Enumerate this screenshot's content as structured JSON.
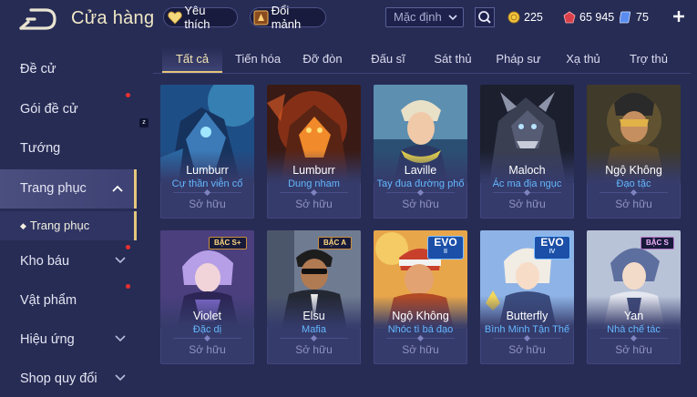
{
  "header": {
    "title": "Cửa hàng",
    "favorite_label": "Yêu thích",
    "fragment_label": "Đổi mảnh",
    "sort_value": "Mặc định",
    "currencies": [
      {
        "name": "gold-coin",
        "value": "225",
        "color": "#f5c842"
      },
      {
        "name": "red-voucher",
        "value": "65 945",
        "color": "#e0454f"
      },
      {
        "name": "blue-gem",
        "value": "75",
        "color": "#7fb2ff"
      }
    ]
  },
  "sidebar": {
    "items": [
      {
        "label": "Đề cử"
      },
      {
        "label": "Gói đề cử"
      },
      {
        "label": "Tướng"
      },
      {
        "label": "Trang phục"
      },
      {
        "label": "Trang phục"
      },
      {
        "label": "Kho báu"
      },
      {
        "label": "Vật phẩm"
      },
      {
        "label": "Hiệu ứng"
      },
      {
        "label": "Shop quy đổi"
      }
    ],
    "badge_mark": "z"
  },
  "tabs": [
    {
      "label": "Tất cả"
    },
    {
      "label": "Tiến hóa"
    },
    {
      "label": "Đỡ đòn"
    },
    {
      "label": "Đấu sĩ"
    },
    {
      "label": "Sát thủ"
    },
    {
      "label": "Pháp sư"
    },
    {
      "label": "Xạ thủ"
    },
    {
      "label": "Trợ thủ"
    }
  ],
  "skins": [
    {
      "hero": "Lumburr",
      "skin": "Cự thần viễn cổ",
      "status": "Sở hữu"
    },
    {
      "hero": "Lumburr",
      "skin": "Dung nham",
      "status": "Sở hữu"
    },
    {
      "hero": "Laville",
      "skin": "Tay đua đường phố",
      "status": "Sở hữu"
    },
    {
      "hero": "Maloch",
      "skin": "Ác ma địa ngục",
      "status": "Sở hữu"
    },
    {
      "hero": "Ngộ Không",
      "skin": "Đạo tặc",
      "status": "Sở hữu"
    },
    {
      "hero": "Violet",
      "skin": "Đặc dị",
      "status": "Sở hữu",
      "badge": "BẬC S+"
    },
    {
      "hero": "Elsu",
      "skin": "Mafia",
      "status": "Sở hữu",
      "badge": "BẬC A"
    },
    {
      "hero": "Ngộ Không",
      "skin": "Nhóc tì bá đạo",
      "status": "Sở hữu",
      "evo": "EVO",
      "evo_level": "II"
    },
    {
      "hero": "Butterfly",
      "skin": "Bình Minh Tận Thế",
      "status": "Sở hữu",
      "evo": "EVO",
      "evo_level": "IV"
    },
    {
      "hero": "Yan",
      "skin": "Nhà chế tác",
      "status": "Sở hữu",
      "badge": "BẬC S"
    }
  ],
  "colors": {
    "background": "#272c55",
    "card": "#353b6b",
    "accent_gold": "#e5c57a",
    "skin_name": "#64b7ff",
    "status_text": "#8f93c2"
  }
}
